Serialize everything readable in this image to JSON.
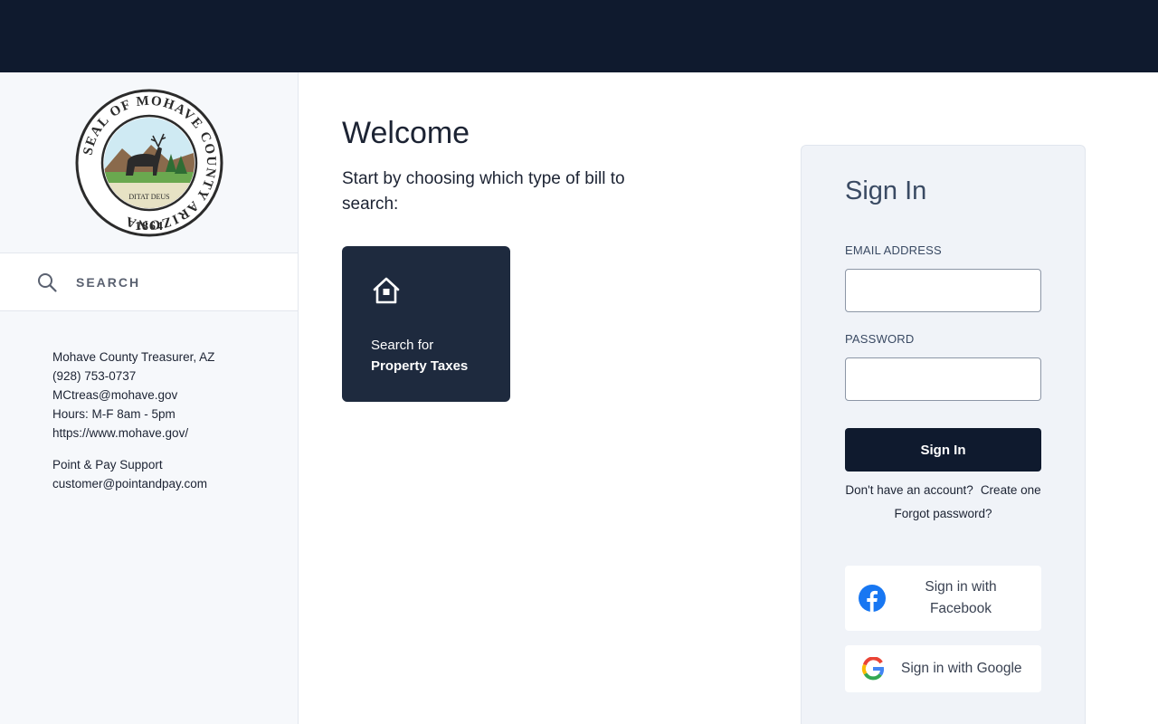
{
  "sidebar": {
    "seal": {
      "ring_text": "SEAL OF MOHAVE COUNTY ARIZONA",
      "motto": "DITAT DEUS",
      "year": "1864"
    },
    "search_label": "SEARCH",
    "contact_lines": [
      "Mohave County Treasurer, AZ",
      "(928) 753-0737",
      "MCtreas@mohave.gov",
      "Hours: M-F 8am - 5pm",
      "https://www.mohave.gov/"
    ],
    "support_lines": [
      "Point & Pay Support",
      "customer@pointandpay.com"
    ]
  },
  "main": {
    "title": "Welcome",
    "subtitle": "Start by choosing which type of bill to search:",
    "tile": {
      "icon": "house-icon",
      "line1": "Search for",
      "line2": "Property Taxes"
    }
  },
  "signin": {
    "title": "Sign In",
    "email_label": "EMAIL ADDRESS",
    "email_value": "",
    "password_label": "PASSWORD",
    "password_value": "",
    "button_label": "Sign In",
    "no_account_text": "Don't have an account?",
    "create_link": "Create one",
    "forgot_link": "Forgot password?",
    "facebook_label": "Sign in with Facebook",
    "google_label": "Sign in with Google"
  },
  "colors": {
    "topbar": "#0f1a2e",
    "tile": "#1e2a3e",
    "primary_button": "#0f1a2e",
    "panel": "#f0f3f8",
    "facebook": "#1877f2"
  }
}
